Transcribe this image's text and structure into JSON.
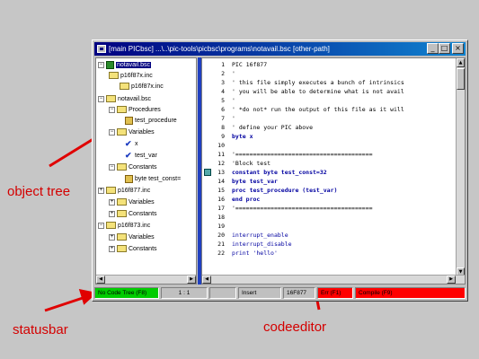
{
  "window": {
    "title": "[main PICbsc] ...\\..\\pic-tools\\picbsc\\programs\\notavail.bsc   [other-path]",
    "btn_min": "_",
    "btn_max": "□",
    "btn_close": "×"
  },
  "annotations": {
    "object_tree": "object tree",
    "statusbar": "statusbar",
    "codeeditor": "codeeditor",
    "color": "#e00000"
  },
  "tree": {
    "items": [
      {
        "label": "notavail.bsc",
        "expander": "−"
      },
      {
        "label": "p16f87x.inc"
      },
      {
        "label": "p16f87x.inc"
      },
      {
        "label": "notavail.bsc",
        "expander": "−"
      },
      {
        "label": "Procedures",
        "expander": "−"
      },
      {
        "label": "test_procedure"
      },
      {
        "label": "Variables",
        "expander": "−"
      },
      {
        "label": "x"
      },
      {
        "label": "test_var"
      },
      {
        "label": "Constants",
        "expander": "−"
      },
      {
        "label": "byte test_const="
      },
      {
        "label": "p16f877.inc",
        "expander": "+"
      },
      {
        "label": "Variables",
        "expander": "+"
      },
      {
        "label": "Constants",
        "expander": "+"
      },
      {
        "label": "p16f873.inc",
        "expander": "−"
      },
      {
        "label": "Variables",
        "expander": "+"
      },
      {
        "label": "Constants",
        "expander": "+"
      }
    ]
  },
  "editor": {
    "lines": [
      {
        "n": "1",
        "text": "PIC 16f877"
      },
      {
        "n": "2",
        "text": "'"
      },
      {
        "n": "3",
        "text": "' this file simply executes a bunch of intrinsics"
      },
      {
        "n": "4",
        "text": "' you will be able to determine what is not avail"
      },
      {
        "n": "5",
        "text": "'"
      },
      {
        "n": "6",
        "text": "' *do not* run the output of this file as it will"
      },
      {
        "n": "7",
        "text": "'"
      },
      {
        "n": "8",
        "text": "' define your PIC above"
      },
      {
        "n": "9",
        "text": "byte x"
      },
      {
        "n": "10",
        "text": ""
      },
      {
        "n": "11",
        "text": "'======================================="
      },
      {
        "n": "12",
        "text": "'Block test"
      },
      {
        "n": "13",
        "text": "constant byte test_const=32"
      },
      {
        "n": "14",
        "text": "byte test_var"
      },
      {
        "n": "15",
        "text": "proc test_procedure (test_var)"
      },
      {
        "n": "16",
        "text": "end proc"
      },
      {
        "n": "17",
        "text": "'======================================="
      },
      {
        "n": "18",
        "text": ""
      },
      {
        "n": "19",
        "text": ""
      },
      {
        "n": "20",
        "text": "interrupt_enable"
      },
      {
        "n": "21",
        "text": "interrupt_disable"
      },
      {
        "n": "22",
        "text": "print 'hello'"
      }
    ]
  },
  "status": {
    "tree_state": "No Code Tree (F8)",
    "position": "1 : 1",
    "blank": "",
    "mode": "Insert",
    "device": "16F877",
    "errors": "Err (F1)",
    "compile": "Compile (F9)"
  },
  "colors": {
    "tree_state_bg": "#00cc00",
    "error_bg": "#ff0000",
    "keyword": "#0000a0",
    "number": "#ff0000",
    "string": "#ff0000",
    "comment": "#000000",
    "splitter": "#2040c0"
  }
}
